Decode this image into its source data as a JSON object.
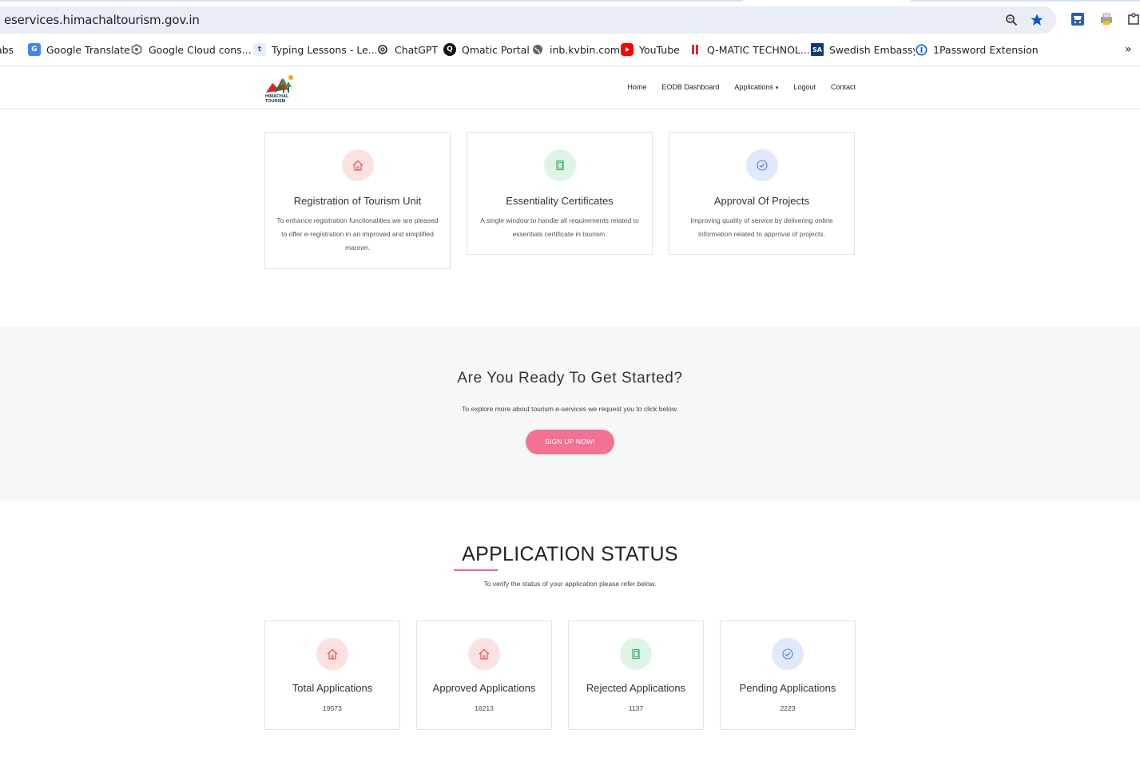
{
  "browser": {
    "url": "eservices.himachaltourism.gov.in",
    "bookmarks": [
      {
        "label": "Labs",
        "icon": "labs-icon"
      },
      {
        "label": "Google Translate",
        "icon": "google-translate-icon"
      },
      {
        "label": "Google Cloud cons...",
        "icon": "google-cloud-icon"
      },
      {
        "label": "Typing Lessons - Le...",
        "icon": "typing-icon"
      },
      {
        "label": "ChatGPT",
        "icon": "chatgpt-icon"
      },
      {
        "label": "Qmatic Portal",
        "icon": "qmatic-icon"
      },
      {
        "label": "inb.kvbin.com",
        "icon": "globe-icon"
      },
      {
        "label": "YouTube",
        "icon": "youtube-icon"
      },
      {
        "label": "Q-MATIC TECHNOL...",
        "icon": "qmatic-tech-icon"
      },
      {
        "label": "Swedish Embassy",
        "icon": "sa-icon"
      },
      {
        "label": "1Password Extension",
        "icon": "onepassword-icon"
      }
    ]
  },
  "site": {
    "logo_text": "HIMACHAL TOURISM",
    "nav": {
      "home": "Home",
      "eodb": "EODB Dashboard",
      "applications": "Applications",
      "logout": "Logout",
      "contact": "Contact"
    }
  },
  "services": [
    {
      "title": "Registration of Tourism Unit",
      "desc": "To enhance registration functionalities we are pleased to offer e-registration in an improved and simplified manner.",
      "icon": "home-icon",
      "color": "#e35757"
    },
    {
      "title": "Essentiality Certificates",
      "desc": "A single window to handle all requirements related to essentials certificate in tourism.",
      "icon": "document-icon",
      "color": "#3cb371"
    },
    {
      "title": "Approval Of Projects",
      "desc": "Improving quality of service by delivering online information related to approval of projects.",
      "icon": "check-circle-icon",
      "color": "#5b78d6"
    }
  ],
  "cta": {
    "title": "Are You Ready To Get Started?",
    "text": "To explore more about tourism e-services we request you to click below.",
    "button": "SIGN UP NOW!"
  },
  "status": {
    "title": "APPLICATION STATUS",
    "subtitle": "To verify the status of your application please refer below.",
    "cards": [
      {
        "label": "Total Applications",
        "value": "19573"
      },
      {
        "label": "Approved Applications",
        "value": "16213"
      },
      {
        "label": "Rejected Applications",
        "value": "1137"
      },
      {
        "label": "Pending Applications",
        "value": "2223"
      }
    ]
  },
  "colors": {
    "accent": "#f27195",
    "underline": "#e8688a"
  }
}
